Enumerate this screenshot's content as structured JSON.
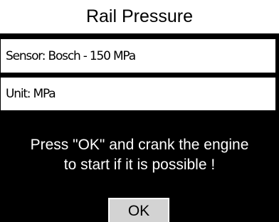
{
  "header": {
    "title": "Rail Pressure"
  },
  "fields": {
    "sensor": "Sensor: Bosch - 150 MPa",
    "unit": "Unit: MPa"
  },
  "message": {
    "text": "Press \"OK\" and crank the engine\nto start if it is possible !"
  },
  "actions": {
    "ok_label": "OK"
  },
  "colors": {
    "background": "#000000",
    "panel": "#ffffff",
    "button": "#d3d3d3"
  }
}
